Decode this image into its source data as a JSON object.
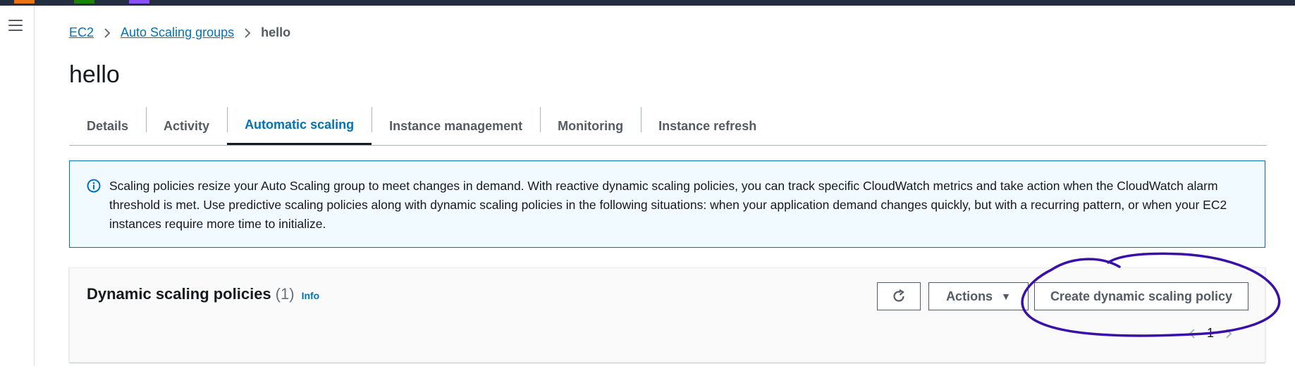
{
  "breadcrumb": {
    "items": [
      "EC2",
      "Auto Scaling groups"
    ],
    "current": "hello"
  },
  "page": {
    "title": "hello"
  },
  "tabs": [
    "Details",
    "Activity",
    "Automatic scaling",
    "Instance management",
    "Monitoring",
    "Instance refresh"
  ],
  "active_tab": "Automatic scaling",
  "alert": {
    "text": "Scaling policies resize your Auto Scaling group to meet changes in demand. With reactive dynamic scaling policies, you can track specific CloudWatch metrics and take action when the CloudWatch alarm threshold is met. Use predictive scaling policies along with dynamic scaling policies in the following situations: when your application demand changes quickly, but with a recurring pattern, or when your EC2 instances require more time to initialize."
  },
  "panel": {
    "title": "Dynamic scaling policies",
    "count": "(1)",
    "info": "Info",
    "actions_label": "Actions",
    "create_label": "Create dynamic scaling policy",
    "page_number": "1"
  },
  "colors": {
    "link": "#0073bb",
    "topbar": "#232f3e",
    "alert_bg": "#f1faff",
    "annotation": "#3a10a8",
    "brand_squares": [
      "#ec7211",
      "#1d8102",
      "#8c4fff"
    ]
  }
}
